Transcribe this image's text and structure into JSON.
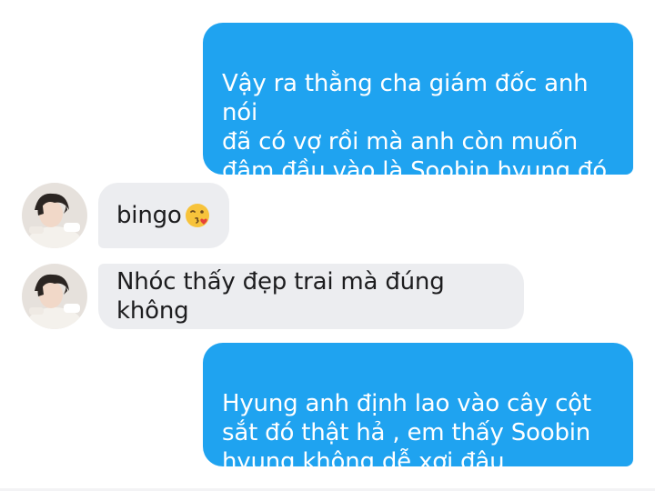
{
  "chat": {
    "messages": [
      {
        "direction": "outgoing",
        "text": "Vậy ra thằng cha giám đốc anh nói\nđã có vợ rồi mà anh còn muốn\nđâm đầu vào là Soobin hyung đó\nhả ??????"
      },
      {
        "direction": "incoming",
        "text": "bingo",
        "emoji": "kissing-wink-emoji"
      },
      {
        "direction": "incoming",
        "text": "Nhóc thấy đẹp trai mà đúng không"
      },
      {
        "direction": "outgoing",
        "text": "Hyung anh định lao vào cây cột\nsắt đó thật hả , em thấy Soobin\nhyung không dễ xơi đâu"
      }
    ]
  },
  "colors": {
    "outgoing_bubble": "#1fa3f0",
    "incoming_bubble": "#ecedf0",
    "outgoing_text": "#ffffff",
    "incoming_text": "#1c1c1e"
  },
  "icons": {
    "avatar": "contact-avatar-photo",
    "emoji": "kissing-wink-emoji"
  }
}
